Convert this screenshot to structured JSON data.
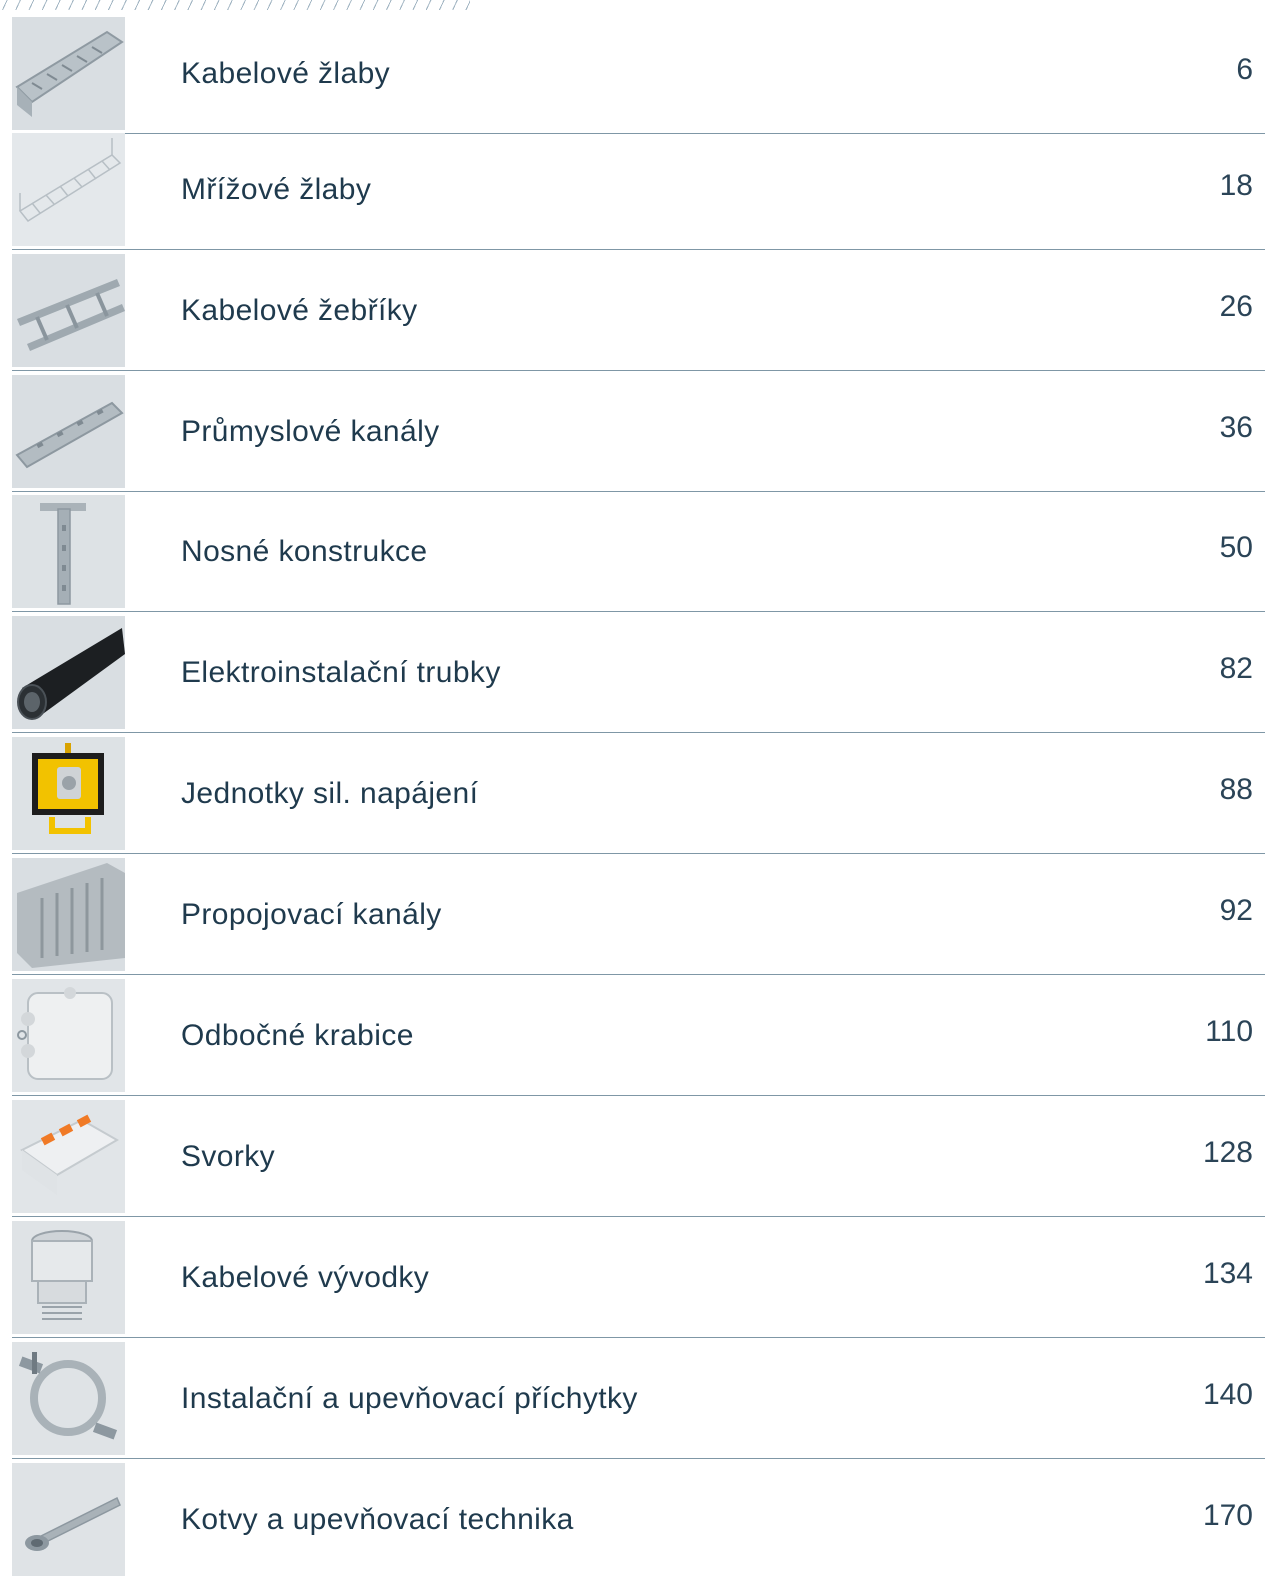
{
  "toc": {
    "items": [
      {
        "label": "Kabelové žlaby",
        "page": "6",
        "icon": "cable-tray-icon"
      },
      {
        "label": "Mřížové žlaby",
        "page": "18",
        "icon": "mesh-tray-icon"
      },
      {
        "label": "Kabelové žebříky",
        "page": "26",
        "icon": "cable-ladder-icon"
      },
      {
        "label": "Průmyslové kanály",
        "page": "36",
        "icon": "industrial-channel-icon"
      },
      {
        "label": "Nosné konstrukce",
        "page": "50",
        "icon": "support-structure-icon"
      },
      {
        "label": "Elektroinstalační trubky",
        "page": "82",
        "icon": "conduit-pipe-icon"
      },
      {
        "label": "Jednotky sil. napájení",
        "page": "88",
        "icon": "power-unit-icon"
      },
      {
        "label": "Propojovací kanály",
        "page": "92",
        "icon": "wiring-duct-icon"
      },
      {
        "label": "Odbočné krabice",
        "page": "110",
        "icon": "junction-box-icon"
      },
      {
        "label": "Svorky",
        "page": "128",
        "icon": "terminal-clamp-icon"
      },
      {
        "label": "Kabelové vývodky",
        "page": "134",
        "icon": "cable-gland-icon"
      },
      {
        "label": "Instalační a upevňovací příchytky",
        "page": "140",
        "icon": "pipe-clip-icon"
      },
      {
        "label": "Kotvy a upevňovací technika",
        "page": "170",
        "icon": "anchor-bolt-icon"
      }
    ]
  },
  "colors": {
    "text": "#1f3a4d",
    "rule": "#7f97a6",
    "thumb_bg": "#d8dde1"
  }
}
